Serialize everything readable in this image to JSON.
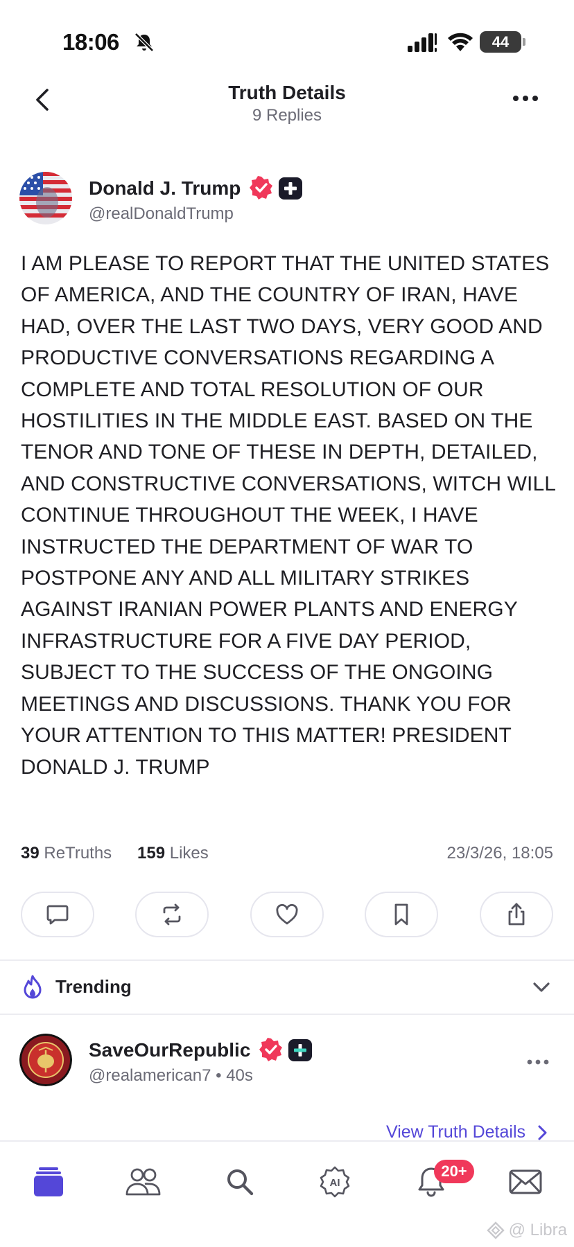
{
  "status_bar": {
    "time": "18:06",
    "battery": "44"
  },
  "header": {
    "title": "Truth Details",
    "subtitle": "9 Replies"
  },
  "post": {
    "author_name": "Donald J. Trump",
    "author_handle": "@realDonaldTrump",
    "text": "I AM PLEASE TO REPORT THAT THE UNITED STATES OF AMERICA, AND THE COUNTRY OF IRAN, HAVE HAD, OVER THE LAST TWO DAYS, VERY GOOD AND PRODUCTIVE CONVERSATIONS REGARDING A COMPLETE AND TOTAL RESOLUTION OF OUR HOSTILITIES IN THE MIDDLE EAST. BASED ON THE TENOR AND TONE OF THESE IN DEPTH, DETAILED, AND CONSTRUCTIVE CONVERSATIONS, WITCH WILL CONTINUE THROUGHOUT THE WEEK, I HAVE INSTRUCTED THE DEPARTMENT OF WAR TO POSTPONE ANY AND ALL MILITARY STRIKES AGAINST IRANIAN POWER PLANTS AND ENERGY INFRASTRUCTURE FOR A FIVE DAY PERIOD, SUBJECT TO THE SUCCESS OF THE ONGOING MEETINGS AND DISCUSSIONS. THANK YOU FOR YOUR ATTENTION TO THIS MATTER! PRESIDENT DONALD J. TRUMP",
    "retruths_count": "39",
    "retruths_label": "ReTruths",
    "likes_count": "159",
    "likes_label": "Likes",
    "date": "23/3/26, 18:05"
  },
  "actions": [
    "reply-icon",
    "retruth-icon",
    "heart-icon",
    "bookmark-icon",
    "share-icon"
  ],
  "trending": {
    "label": "Trending"
  },
  "reply": {
    "author_name": "SaveOurRepublic",
    "author_handle": "@realamerican7",
    "separator": "•",
    "time_ago": "40s",
    "view_link": "View Truth Details"
  },
  "nav": {
    "items": [
      "home-icon",
      "groups-icon",
      "search-icon",
      "ai-icon",
      "notifications-icon",
      "messages-icon"
    ],
    "notification_badge": "20+"
  },
  "watermark": "@ Libra",
  "colors": {
    "accent": "#5447d8",
    "verified": "#f0385a",
    "text": "#1f1f24",
    "muted": "#6b6b76"
  }
}
